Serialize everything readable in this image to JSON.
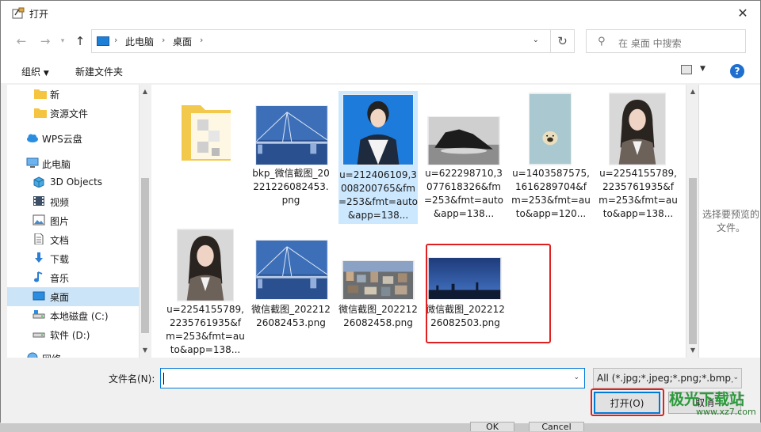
{
  "window": {
    "title": "打开"
  },
  "address": {
    "crumbs": [
      "此电脑",
      "桌面"
    ]
  },
  "search": {
    "placeholder": "在 桌面 中搜索"
  },
  "toolbar": {
    "organize": "组织",
    "new_folder": "新建文件夹"
  },
  "sidebar": {
    "items": [
      {
        "label": "新",
        "icon": "folder-icon"
      },
      {
        "label": "资源文件",
        "icon": "folder-icon"
      },
      {
        "label": "WPS云盘",
        "icon": "cloud-icon"
      },
      {
        "label": "此电脑",
        "icon": "computer-icon"
      },
      {
        "label": "3D Objects",
        "icon": "cube-icon"
      },
      {
        "label": "视频",
        "icon": "video-icon"
      },
      {
        "label": "图片",
        "icon": "picture-icon"
      },
      {
        "label": "文档",
        "icon": "document-icon"
      },
      {
        "label": "下载",
        "icon": "download-icon"
      },
      {
        "label": "音乐",
        "icon": "music-icon"
      },
      {
        "label": "桌面",
        "icon": "desktop-icon",
        "selected": true
      },
      {
        "label": "本地磁盘 (C:)",
        "icon": "drive-icon"
      },
      {
        "label": "软件 (D:)",
        "icon": "drive-icon"
      },
      {
        "label": "网络",
        "icon": "network-icon"
      }
    ]
  },
  "files": [
    {
      "name": "",
      "kind": "folder"
    },
    {
      "name": "bkp_微信截图_20221226082453.png",
      "kind": "bridge"
    },
    {
      "name": "u=212406109,3008200765&fm=253&fmt=auto&app=138...",
      "kind": "portrait-blue",
      "selected": true
    },
    {
      "name": "u=622298710,3077618326&fm=253&fmt=auto&app=138...",
      "kind": "rock"
    },
    {
      "name": "u=1403587575,1616289704&fm=253&fmt=auto&app=120...",
      "kind": "pug"
    },
    {
      "name": "u=2254155789,2235761935&fm=253&fmt=auto&app=138...",
      "kind": "portrait-grey"
    },
    {
      "name": "u=2254155789,2235761935&fm=253&fmt=auto&app=138...",
      "kind": "portrait-grey"
    },
    {
      "name": "微信截图_20221226082453.png",
      "kind": "bridge"
    },
    {
      "name": "微信截图_20221226082458.png",
      "kind": "city"
    },
    {
      "name": "微信截图_20221226082503.png",
      "kind": "sunset",
      "highlighted": true
    }
  ],
  "preview": {
    "text": "选择要预览的文件。"
  },
  "footer": {
    "filename_label": "文件名(N):",
    "filename_value": "",
    "filetype": "All (*.jpg;*.jpeg;*.png;*.bmp;*",
    "open_label": "打开(O)",
    "cancel_label": "取消",
    "behind_ok": "OK",
    "behind_cancel": "Cancel"
  },
  "watermark": {
    "text": "极光下载站",
    "url": "www.xz7.com"
  },
  "colors": {
    "highlight": "#e02020",
    "selection": "#cce8ff",
    "accent": "#0078d7"
  }
}
